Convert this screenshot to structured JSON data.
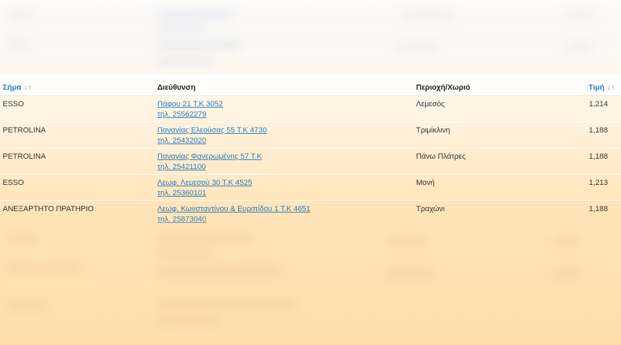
{
  "table": {
    "columns": {
      "brand": "Σήμα",
      "address": "Διεύθυνση",
      "area": "Περιοχή/Χωριό",
      "price": "Τιμή"
    },
    "sort_arrows": "↓↑",
    "rows": [
      {
        "brand": "ESSO",
        "address": "Πάφου 21 Τ.Κ 3052",
        "phone": "τηλ. 25562279",
        "area": "Λεμεσός",
        "price": "1,214"
      },
      {
        "brand": "PETROLINA",
        "address": "Παναγίας Ελεούσας 55 Τ.Κ 4730",
        "phone": "τηλ. 25432020",
        "area": "Τριμίκλινη",
        "price": "1,188"
      },
      {
        "brand": "PETROLINA",
        "address": "Παναγίας Φανερωμένης 57 Τ.Κ",
        "phone": "τηλ. 25421100",
        "area": "Πάνω Πλάτρες",
        "price": "1,188"
      },
      {
        "brand": "ESSO",
        "address": "Λεωφ. Λεμεσού 30 Τ.Κ 4525",
        "phone": "τηλ. 25360101",
        "area": "Μονή",
        "price": "1,213"
      },
      {
        "brand": "ΑΝΕΞΑΡΤΗΤΟ ΠΡΑΤΗΡΙΟ",
        "address": "Λεωφ. Κωνσταντίνου & Ευριπίδου 1 Τ.Κ 4651",
        "phone": "τηλ. 25873040",
        "area": "Τραχώνι",
        "price": "1,188"
      }
    ]
  },
  "colors": {
    "link": "#2a7fc0",
    "text": "#333333",
    "header_text": "#222222"
  }
}
